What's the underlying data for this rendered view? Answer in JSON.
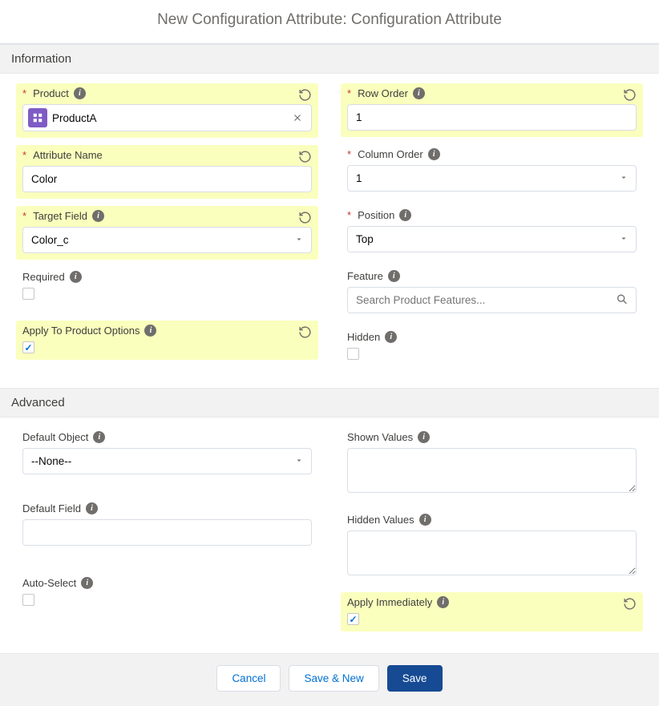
{
  "title": "New Configuration Attribute: Configuration Attribute",
  "sections": {
    "info": "Information",
    "adv": "Advanced"
  },
  "left": {
    "product": {
      "label": "Product",
      "value": "ProductA"
    },
    "attrName": {
      "label": "Attribute Name",
      "value": "Color"
    },
    "targetField": {
      "label": "Target Field",
      "value": "Color_c"
    },
    "required": {
      "label": "Required",
      "checked": false
    },
    "applyToOptions": {
      "label": "Apply To Product Options",
      "checked": true
    },
    "defaultObject": {
      "label": "Default Object",
      "value": "--None--"
    },
    "defaultField": {
      "label": "Default Field",
      "value": ""
    },
    "autoSelect": {
      "label": "Auto-Select",
      "checked": false
    }
  },
  "right": {
    "rowOrder": {
      "label": "Row Order",
      "value": "1"
    },
    "colOrder": {
      "label": "Column Order",
      "value": "1"
    },
    "position": {
      "label": "Position",
      "value": "Top"
    },
    "feature": {
      "label": "Feature",
      "placeholder": "Search Product Features..."
    },
    "hidden": {
      "label": "Hidden",
      "checked": false
    },
    "shownValues": {
      "label": "Shown Values",
      "value": ""
    },
    "hiddenValues": {
      "label": "Hidden Values",
      "value": ""
    },
    "applyImmediately": {
      "label": "Apply Immediately",
      "checked": true
    }
  },
  "footer": {
    "cancel": "Cancel",
    "saveNew": "Save & New",
    "save": "Save"
  }
}
